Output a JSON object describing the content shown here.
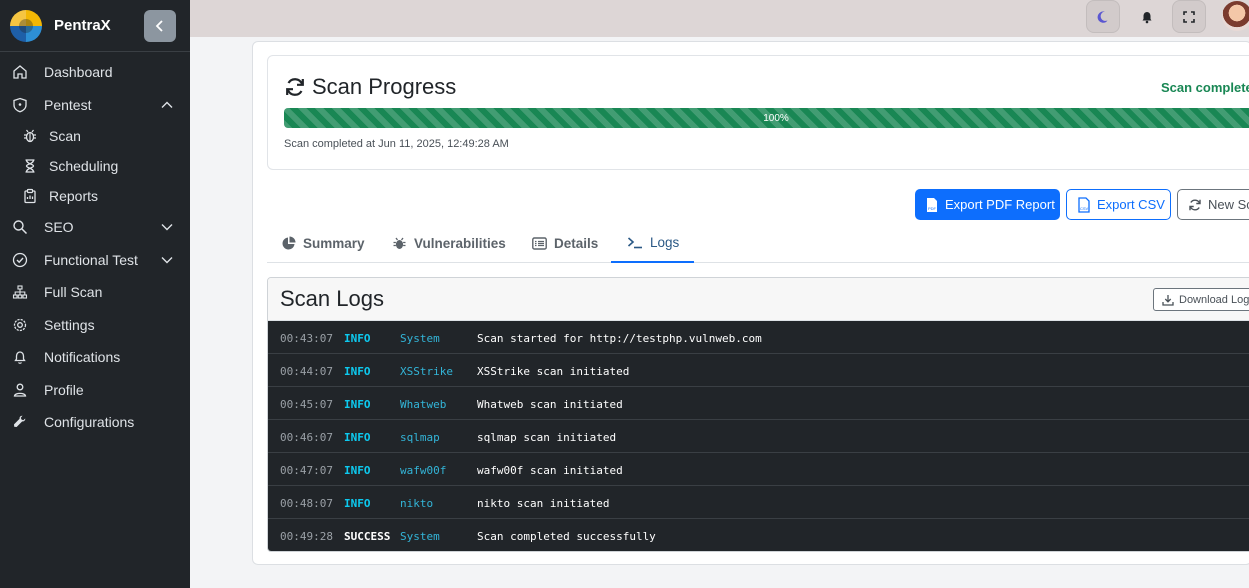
{
  "app": {
    "name": "PentraX"
  },
  "sidebar": {
    "items": [
      {
        "label": "Dashboard",
        "icon": "home-icon"
      },
      {
        "label": "Pentest",
        "icon": "shield-icon",
        "expanded": true
      },
      {
        "label": "Scan",
        "icon": "bug-icon"
      },
      {
        "label": "Scheduling",
        "icon": "hourglass-icon"
      },
      {
        "label": "Reports",
        "icon": "clipboard-icon"
      },
      {
        "label": "SEO",
        "icon": "search-icon",
        "expanded": false
      },
      {
        "label": "Functional Test",
        "icon": "check-circle-icon",
        "expanded": false
      },
      {
        "label": "Full Scan",
        "icon": "sitemap-icon"
      },
      {
        "label": "Settings",
        "icon": "gear-icon"
      },
      {
        "label": "Notifications",
        "icon": "bell-icon"
      },
      {
        "label": "Profile",
        "icon": "user-icon"
      },
      {
        "label": "Configurations",
        "icon": "wrench-icon"
      }
    ]
  },
  "progress": {
    "title": "Scan Progress",
    "status": "Scan complete",
    "percent": 100,
    "percent_label": "100%",
    "completed_text": "Scan completed at Jun 11, 2025, 12:49:28 AM"
  },
  "actions": {
    "export_pdf": "Export PDF Report",
    "export_csv": "Export CSV",
    "new_scan": "New Sc"
  },
  "tabs": [
    {
      "label": "Summary",
      "icon": "pie-chart-icon"
    },
    {
      "label": "Vulnerabilities",
      "icon": "bug-icon"
    },
    {
      "label": "Details",
      "icon": "list-icon"
    },
    {
      "label": "Logs",
      "icon": "terminal-icon",
      "active": true
    }
  ],
  "logs": {
    "title": "Scan Logs",
    "download_label": "Download Logs",
    "rows": [
      {
        "time": "00:43:07",
        "level": "INFO",
        "source": "System",
        "message": "Scan started for http://testphp.vulnweb.com"
      },
      {
        "time": "00:44:07",
        "level": "INFO",
        "source": "XSStrike",
        "message": "XSStrike scan initiated"
      },
      {
        "time": "00:45:07",
        "level": "INFO",
        "source": "Whatweb",
        "message": "Whatweb scan initiated"
      },
      {
        "time": "00:46:07",
        "level": "INFO",
        "source": "sqlmap",
        "message": "sqlmap scan initiated"
      },
      {
        "time": "00:47:07",
        "level": "INFO",
        "source": "wafw00f",
        "message": "wafw00f scan initiated"
      },
      {
        "time": "00:48:07",
        "level": "INFO",
        "source": "nikto",
        "message": "nikto scan initiated"
      },
      {
        "time": "00:49:28",
        "level": "SUCCESS",
        "source": "System",
        "message": "Scan completed successfully"
      }
    ]
  },
  "colors": {
    "sidebar_bg": "#212529",
    "primary": "#0d6efd",
    "success": "#198754",
    "log_bg": "#212529",
    "info": "#0dcaf0"
  }
}
